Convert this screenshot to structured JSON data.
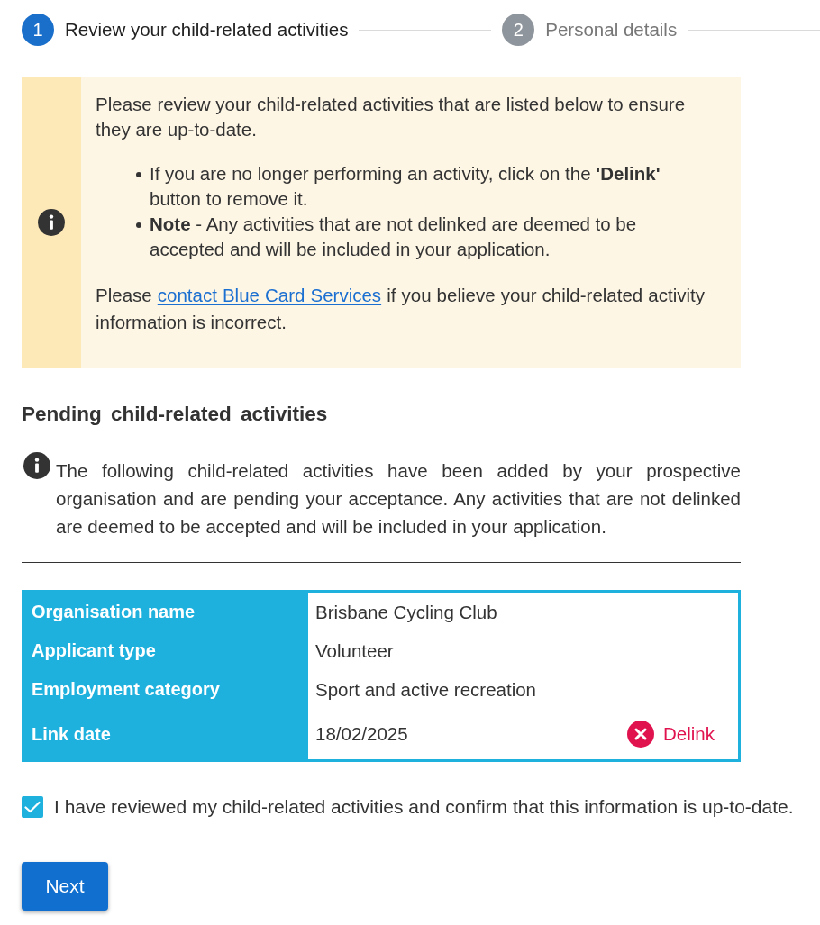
{
  "stepper": {
    "steps": [
      {
        "number": "1",
        "label": "Review your child-related activities",
        "active": true
      },
      {
        "number": "2",
        "label": "Personal details",
        "active": false
      }
    ]
  },
  "notice": {
    "intro": "Please review your child-related activities that are listed below to ensure they are up-to-date.",
    "bullets": [
      "If you are no longer performing an activity, click on the **'Delink'** button to remove it.",
      "**Note** - Any activities that are not delinked are deemed to be accepted and will be included in your application."
    ],
    "closing": {
      "before": "Please ",
      "link": "contact Blue Card Services",
      "after": " if you believe your child-related activity information is incorrect."
    }
  },
  "pending": {
    "heading": "Pending child-related activities",
    "description": "The following child-related activities have been added by your prospective organisation and are pending your acceptance. Any activities that are not delinked are deemed to be accepted and will be included in your application.",
    "activities": [
      {
        "fields": [
          {
            "label": "Organisation name",
            "value": "Brisbane Cycling Club"
          },
          {
            "label": "Applicant type",
            "value": "Volunteer"
          },
          {
            "label": "Employment category",
            "value": "Sport and active recreation"
          },
          {
            "label": "Link date",
            "value": "18/02/2025"
          }
        ],
        "delink_label": "Delink"
      }
    ]
  },
  "confirmation": {
    "label": "I have reviewed my child-related activities and confirm that this information is up-to-date.",
    "checked": true
  },
  "buttons": [
    {
      "label": "Next"
    }
  ]
}
